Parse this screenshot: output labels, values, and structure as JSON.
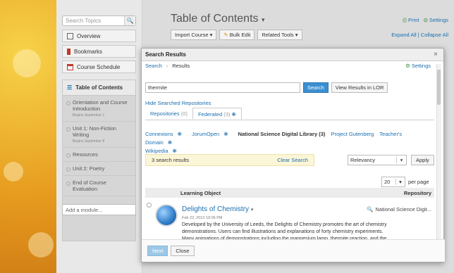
{
  "sidebar": {
    "search_placeholder": "Search Topics",
    "nav": [
      {
        "label": "Overview",
        "icon": "document-icon"
      },
      {
        "label": "Bookmarks",
        "icon": "bookmark-icon"
      },
      {
        "label": "Course Schedule",
        "icon": "calendar-icon"
      }
    ],
    "toc_title": "Table of Contents",
    "toc_items": [
      {
        "label": "Orientation and Course Introduction",
        "sub": "Begins September 1"
      },
      {
        "label": "Unit 1: Non-Fiction Writing",
        "sub": "Begins September 8"
      },
      {
        "label": "Resources",
        "sub": ""
      },
      {
        "label": "Unit 2: Poetry",
        "sub": ""
      },
      {
        "label": "End of Course Evaluation",
        "sub": ""
      }
    ],
    "add_module_placeholder": "Add a module..."
  },
  "main": {
    "title": "Table of Contents",
    "toolbar": {
      "import": "Import Course",
      "bulk_edit": "Bulk Edit",
      "related_tools": "Related Tools"
    },
    "print": "Print",
    "settings": "Settings",
    "expand_all": "Expand All",
    "collapse_all": "Collapse All"
  },
  "dialog": {
    "title": "Search Results",
    "breadcrumb": {
      "search": "Search",
      "results": "Results"
    },
    "settings": "Settings",
    "query": "thermite",
    "search_button": "Search",
    "view_lor_button": "View Results in LOR",
    "hide_repos": "Hide Searched Repositories",
    "tabs": [
      {
        "label": "Repositories",
        "count": "(0)"
      },
      {
        "label": "Federated",
        "count": "(3)"
      }
    ],
    "repositories": [
      "Connexions",
      "JorumOpen",
      "National Science Digital Library (3)",
      "Project Gutenberg",
      "Teacher's Domain",
      "Wikipedia"
    ],
    "results_count": "3 search results",
    "clear_search": "Clear Search",
    "sort": "Relevancy",
    "apply": "Apply",
    "per_page_value": "20",
    "per_page_label": "per page",
    "col_learning_object": "Learning Object",
    "col_repository": "Repository",
    "result": {
      "title": "Delights of Chemistry",
      "date": "Feb 22, 2012 10:05 PM",
      "repository": "National Science Digit...",
      "description": "Developed by the University of Leeds, the Delights of Chemistry promotes the art of chemistry demonstrations. Users can find illustrations and explanations of forty chemistry experiments. Many animations of demonstrations including the magnesium lamp, thermite reaction, and the"
    },
    "next": "Next",
    "close": "Close"
  },
  "colors": {
    "accent": "#3b8fd1",
    "link": "#1a6fb0",
    "highlight": "#fcf6d8"
  }
}
